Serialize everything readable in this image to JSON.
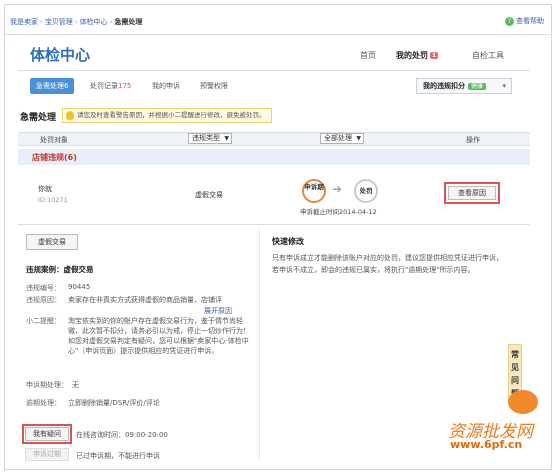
{
  "breadcrumb": {
    "items": [
      "我是卖家",
      "宝贝管理",
      "体检中心"
    ],
    "current": "急需处理"
  },
  "help": {
    "label": "查看帮助"
  },
  "header": {
    "title": "体检中心"
  },
  "nav": [
    {
      "label": "首页"
    },
    {
      "label": "我的处罚",
      "badge": "1"
    },
    {
      "label": "自检工具"
    }
  ],
  "tabs": [
    {
      "label": "急需处理6"
    },
    {
      "label": "处罚记录",
      "count": "175"
    },
    {
      "label": "我的申诉"
    },
    {
      "label": "预警权限"
    }
  ],
  "score": {
    "label": "我的违规扣分",
    "status": "健康",
    "caret": "▾"
  },
  "urgent": {
    "title": "急需处理",
    "tip": "请您及时查看警告原因，并根据小二提醒进行修改，避免被处罚。"
  },
  "table": {
    "headers": {
      "object": "处罚对象",
      "type_select": "违规类型",
      "status_select": "全部处理",
      "action": "操作"
    },
    "group_title": "店铺违规(6)",
    "row": {
      "name": "你就",
      "id": "ID:10271",
      "type": "虚假交易",
      "step1": "申诉期",
      "step2": "处罚",
      "arrow": "➜",
      "deadline": "申诉截止时间2014-04-12",
      "action": "查看原因"
    }
  },
  "detail": {
    "tag": "虚假交易",
    "case_label": "违规案例：",
    "case_value": "虚假交易",
    "fields": [
      {
        "label": "违规编号：",
        "value": "90445"
      },
      {
        "label": "违规原因：",
        "value": "卖家存在非真实方式获得虚假的商品销量、店铺评"
      }
    ],
    "expand": "展开原因",
    "reminder_label": "小二提醒：",
    "reminder": "淘宝依实到的你的账户存在虚假交易行为，鉴于情节尚轻微，此次暂不扣分，请务必引以为戒，停止一切炒作行为！如您对虚假交易判定有疑问，您可以根据\"卖家中心-体检中心\"（申诉页面）提示提供相应的凭证进行申诉。",
    "appeal_label": "申诉期处理：",
    "appeal_value": "无",
    "expire_label": "逾期处理：",
    "expire_value": "立即删除销量/DSR/评价/评论",
    "question_btn": "我有疑问",
    "online_time": "在线咨询时间：09:00-20:00",
    "appeal_btn": "申诉过期",
    "appeal_note": "已过申诉期，不能进行申诉"
  },
  "quick": {
    "title": "快速修改",
    "text": "只有申诉成立才能删除该账户对应的处罚，建议您提供相应凭证进行申诉，若申诉不成立，即会的违规已属实，将执行\"逾期处理\"所示内容。"
  },
  "float": {
    "label": "常见问题"
  },
  "watermark": {
    "text": "资源批发网",
    "url": "www.6pf.cn"
  },
  "colors": {
    "accent": "#2f6fb8",
    "tab_active": "#4a90d9",
    "alert": "#d9534f",
    "ok": "#5cb85c"
  }
}
